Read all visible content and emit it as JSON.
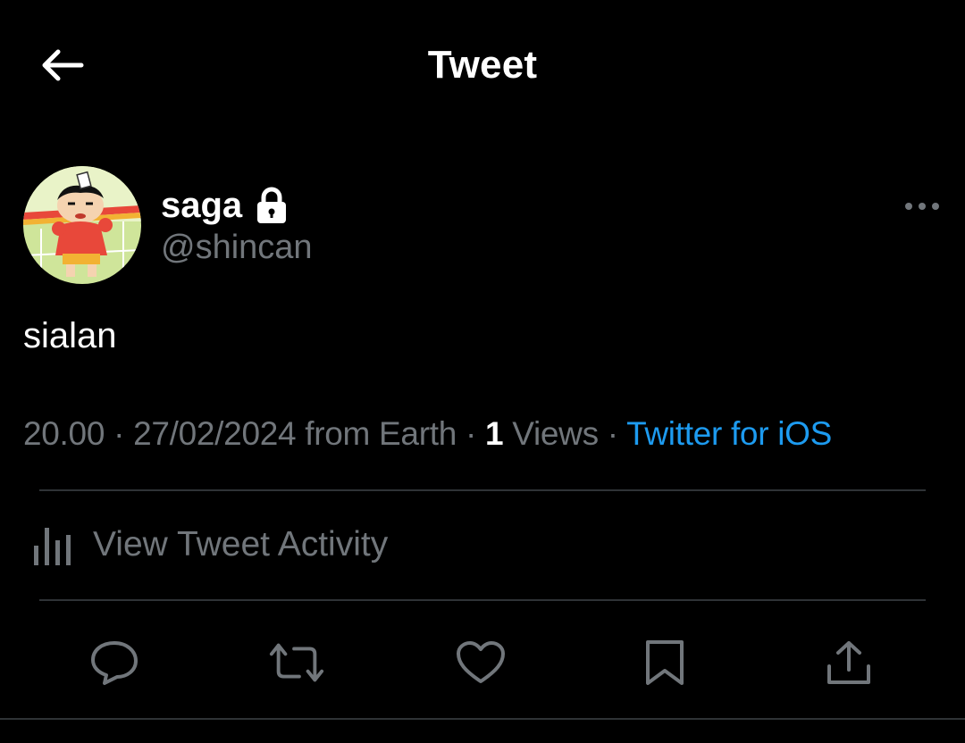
{
  "header": {
    "title": "Tweet",
    "back_icon": "arrow-left-icon"
  },
  "author": {
    "display_name": "saga",
    "handle": "@shincan",
    "protected_icon": "lock-icon",
    "avatar_desc": "cartoon-avatar"
  },
  "tweet": {
    "text": "sialan",
    "time": "20.00",
    "date": "27/02/2024",
    "location": "from Earth",
    "views_count": "1",
    "views_label": "Views",
    "source": "Twitter for iOS",
    "separator": "·"
  },
  "activity": {
    "label": "View Tweet Activity",
    "icon": "analytics-bar-icon"
  },
  "actions": {
    "reply_icon": "reply-icon",
    "retweet_icon": "retweet-icon",
    "like_icon": "heart-icon",
    "bookmark_icon": "bookmark-icon",
    "share_icon": "share-icon"
  },
  "colors": {
    "background": "#000000",
    "primary_text": "#ffffff",
    "secondary_text": "#71767b",
    "link": "#1d9bf0",
    "divider": "#2f3336"
  }
}
